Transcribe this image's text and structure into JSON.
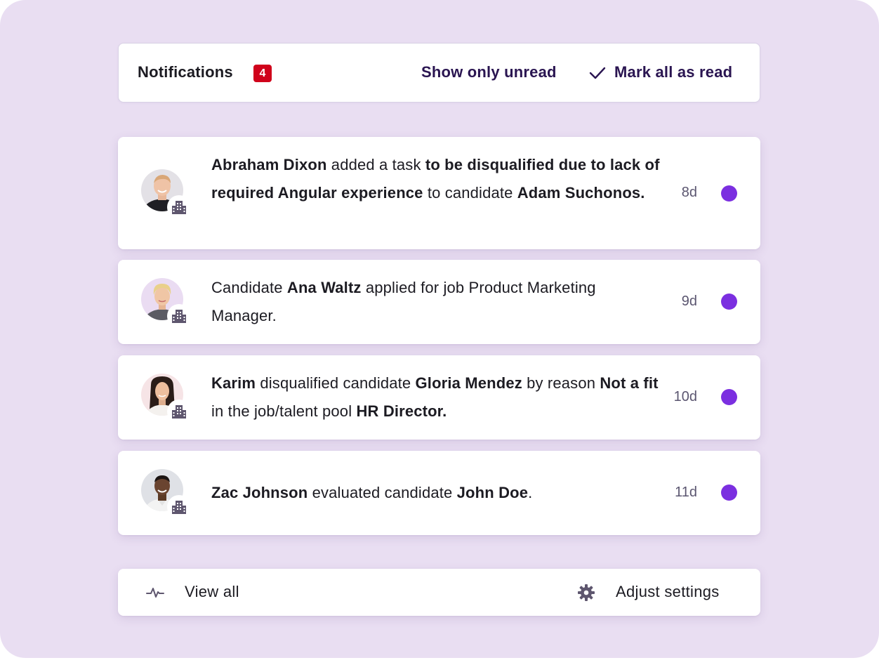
{
  "header": {
    "title": "Notifications",
    "unread_count": "4",
    "show_unread_label": "Show only unread",
    "mark_all_label": "Mark all as read"
  },
  "notifications": [
    {
      "segments": [
        {
          "t": "Abraham Dixon",
          "b": true
        },
        {
          "t": " added a task ",
          "b": false
        },
        {
          "t": "to be disqualified due to lack of required Angular experience",
          "b": true
        },
        {
          "t": " to candidate ",
          "b": false
        },
        {
          "t": "Adam Suchonos.",
          "b": true
        }
      ],
      "time": "8d",
      "unread": true,
      "avatar": "man-avatar-1"
    },
    {
      "segments": [
        {
          "t": "Candidate ",
          "b": false
        },
        {
          "t": "Ana Waltz",
          "b": true
        },
        {
          "t": " applied for job Product Marketing Manager.",
          "b": false
        }
      ],
      "time": "9d",
      "unread": true,
      "avatar": "woman-avatar-1"
    },
    {
      "segments": [
        {
          "t": "Karim",
          "b": true
        },
        {
          "t": " disqualified candidate ",
          "b": false
        },
        {
          "t": "Gloria Mendez",
          "b": true
        },
        {
          "t": " by reason ",
          "b": false
        },
        {
          "t": "Not a fit",
          "b": true
        },
        {
          "t": " in the job/talent pool ",
          "b": false
        },
        {
          "t": "HR Director.",
          "b": true
        }
      ],
      "time": "10d",
      "unread": true,
      "avatar": "woman-avatar-2"
    },
    {
      "segments": [
        {
          "t": "Zac Johnson",
          "b": true
        },
        {
          "t": " evaluated candidate ",
          "b": false
        },
        {
          "t": "John Doe",
          "b": true
        },
        {
          "t": ".",
          "b": false
        }
      ],
      "time": "11d",
      "unread": true,
      "avatar": "man-avatar-2"
    }
  ],
  "footer": {
    "view_all_label": "View all",
    "settings_label": "Adjust settings",
    "view_all_icon": "activity-pulse-icon",
    "settings_icon": "gear-icon"
  },
  "colors": {
    "background": "#e9def2",
    "badge": "#d0021b",
    "unread_dot": "#7b2fe0",
    "link": "#2a1551"
  }
}
